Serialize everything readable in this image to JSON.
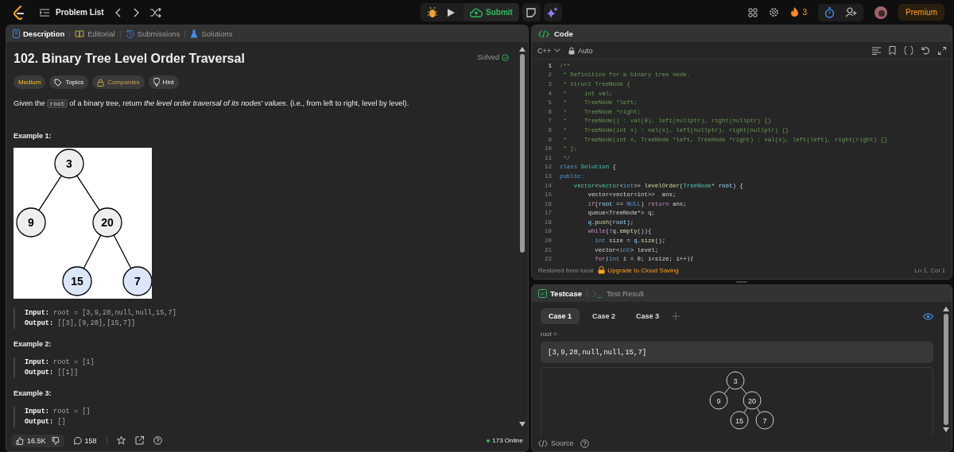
{
  "topbar": {
    "problem_list": "Problem List",
    "submit": "Submit",
    "streak": "3",
    "premium": "Premium"
  },
  "description_panel": {
    "tabs": [
      {
        "label": "Description",
        "kind": "description",
        "selected": true
      },
      {
        "label": "Editorial",
        "kind": "editorial",
        "selected": false
      },
      {
        "label": "Submissions",
        "kind": "submissions",
        "selected": false
      },
      {
        "label": "Solutions",
        "kind": "solutions",
        "selected": false
      }
    ],
    "title": "102. Binary Tree Level Order Traversal",
    "status": "Solved",
    "tags": [
      {
        "label": "Medium",
        "kind": "difficulty"
      },
      {
        "label": "Topics",
        "kind": "topics"
      },
      {
        "label": "Companies",
        "kind": "companies"
      },
      {
        "label": "Hint",
        "kind": "hint"
      }
    ],
    "statement": [
      {
        "kind": "text",
        "text": "Given the "
      },
      {
        "kind": "code",
        "text": "root"
      },
      {
        "kind": "text",
        "text": " of a binary tree, return "
      },
      {
        "kind": "italic",
        "text": "the level order traversal of its nodes' values"
      },
      {
        "kind": "text",
        "text": ". (i.e., from left to right, level by level)."
      }
    ],
    "examples": [
      {
        "title": "Example 1:",
        "figure": {
          "kind": "picture",
          "tree": {
            "label": "3",
            "color": "#eeeeee",
            "children": [
              {
                "label": "9",
                "color": "#eeeeee"
              },
              {
                "label": "20",
                "color": "#eeeeee",
                "children": [
                  {
                    "label": "15",
                    "color": "#dbe6f8"
                  },
                  {
                    "label": "7",
                    "color": "#dbe6f8"
                  }
                ]
              }
            ]
          }
        },
        "lines": [
          "**Input:** root = [3,9,20,null,null,15,7]",
          "**Output:** [[3],[9,20],[15,7]]"
        ]
      },
      {
        "title": "Example 2:",
        "lines": [
          "**Input:** root = [1]",
          "**Output:** [[1]]"
        ]
      },
      {
        "title": "Example 3:",
        "lines": [
          "**Input:** root = []",
          "**Output:** []"
        ]
      }
    ],
    "footer": {
      "likes": "16.5K",
      "comments": "158",
      "online": "173 Online"
    }
  },
  "code_panel": {
    "title": "Code",
    "language": "C++",
    "mode": "Auto",
    "lines": [
      {
        "number": "1",
        "current": true,
        "tokens": [
          {
            "kind": "comment",
            "text": "/**"
          }
        ]
      },
      {
        "number": "2",
        "current": false,
        "tokens": [
          {
            "kind": "comment",
            "text": " * Definition for a binary tree node."
          }
        ]
      },
      {
        "number": "3",
        "current": false,
        "tokens": [
          {
            "kind": "comment",
            "text": " * struct TreeNode {"
          }
        ]
      },
      {
        "number": "4",
        "current": false,
        "tokens": [
          {
            "kind": "comment",
            "text": " *     int val;"
          }
        ]
      },
      {
        "number": "5",
        "current": false,
        "tokens": [
          {
            "kind": "comment",
            "text": " *     TreeNode *left;"
          }
        ]
      },
      {
        "number": "6",
        "current": false,
        "tokens": [
          {
            "kind": "comment",
            "text": " *     TreeNode *right;"
          }
        ]
      },
      {
        "number": "7",
        "current": false,
        "tokens": [
          {
            "kind": "comment",
            "text": " *     TreeNode() : val(0), left(nullptr), right(nullptr) {}"
          }
        ]
      },
      {
        "number": "8",
        "current": false,
        "tokens": [
          {
            "kind": "comment",
            "text": " *     TreeNode(int x) : val(x), left(nullptr), right(nullptr) {}"
          }
        ]
      },
      {
        "number": "9",
        "current": false,
        "tokens": [
          {
            "kind": "comment",
            "text": " *     TreeNode(int x, TreeNode *left, TreeNode *right) : val(x), left(left), right(right) {}"
          }
        ]
      },
      {
        "number": "10",
        "current": false,
        "tokens": [
          {
            "kind": "comment",
            "text": " * };"
          }
        ]
      },
      {
        "number": "11",
        "current": false,
        "tokens": [
          {
            "kind": "comment",
            "text": " */"
          }
        ]
      },
      {
        "number": "12",
        "current": false,
        "tokens": [
          {
            "kind": "keyword",
            "text": "class"
          },
          {
            "kind": "type",
            "text": " Solution"
          },
          {
            "kind": "plain",
            "text": " {"
          }
        ]
      },
      {
        "number": "13",
        "current": false,
        "tokens": [
          {
            "kind": "keyword",
            "text": "public:"
          }
        ]
      },
      {
        "number": "14",
        "current": false,
        "tokens": [
          {
            "kind": "type",
            "text": "    vector"
          },
          {
            "kind": "plain",
            "text": "<"
          },
          {
            "kind": "type",
            "text": "vector"
          },
          {
            "kind": "plain",
            "text": "<"
          },
          {
            "kind": "keyword",
            "text": "int"
          },
          {
            "kind": "plain",
            "text": ">> "
          },
          {
            "kind": "func",
            "text": "levelOrder"
          },
          {
            "kind": "plain",
            "text": "("
          },
          {
            "kind": "type",
            "text": "TreeNode"
          },
          {
            "kind": "plain",
            "text": "* "
          },
          {
            "kind": "var",
            "text": "root"
          },
          {
            "kind": "plain",
            "text": ") {"
          }
        ]
      },
      {
        "number": "15",
        "current": false,
        "tokens": [
          {
            "kind": "plain",
            "text": "        vector<vector<int>>  ans;"
          }
        ]
      },
      {
        "number": "16",
        "current": false,
        "tokens": [
          {
            "kind": "control",
            "text": "        if"
          },
          {
            "kind": "plain",
            "text": "("
          },
          {
            "kind": "var",
            "text": "root"
          },
          {
            "kind": "plain",
            "text": " == "
          },
          {
            "kind": "keyword",
            "text": "NULL"
          },
          {
            "kind": "plain",
            "text": ") "
          },
          {
            "kind": "control",
            "text": "return"
          },
          {
            "kind": "plain",
            "text": " ans;"
          }
        ]
      },
      {
        "number": "17",
        "current": false,
        "tokens": [
          {
            "kind": "plain",
            "text": "        queue<TreeNode*> q;"
          }
        ]
      },
      {
        "number": "18",
        "current": false,
        "tokens": [
          {
            "kind": "var",
            "text": "        q"
          },
          {
            "kind": "plain",
            "text": "."
          },
          {
            "kind": "func",
            "text": "push"
          },
          {
            "kind": "plain",
            "text": "("
          },
          {
            "kind": "var",
            "text": "root"
          },
          {
            "kind": "plain",
            "text": ");"
          }
        ]
      },
      {
        "number": "19",
        "current": false,
        "tokens": [
          {
            "kind": "control",
            "text": "        while"
          },
          {
            "kind": "plain",
            "text": "(!"
          },
          {
            "kind": "var",
            "text": "q"
          },
          {
            "kind": "plain",
            "text": "."
          },
          {
            "kind": "func",
            "text": "empty"
          },
          {
            "kind": "plain",
            "text": "()){"
          }
        ]
      },
      {
        "number": "20",
        "current": false,
        "tokens": [
          {
            "kind": "keyword",
            "text": "          int"
          },
          {
            "kind": "plain",
            "text": " size = "
          },
          {
            "kind": "var",
            "text": "q"
          },
          {
            "kind": "plain",
            "text": "."
          },
          {
            "kind": "func",
            "text": "size"
          },
          {
            "kind": "plain",
            "text": "();"
          }
        ]
      },
      {
        "number": "21",
        "current": false,
        "tokens": [
          {
            "kind": "plain",
            "text": "          vector<"
          },
          {
            "kind": "keyword",
            "text": "int"
          },
          {
            "kind": "plain",
            "text": "> level;"
          }
        ]
      },
      {
        "number": "22",
        "current": false,
        "tokens": [
          {
            "kind": "control",
            "text": "          for"
          },
          {
            "kind": "plain",
            "text": "("
          },
          {
            "kind": "keyword",
            "text": "int"
          },
          {
            "kind": "plain",
            "text": " i = 0; i<size; i++){"
          }
        ]
      }
    ],
    "status": "Restored from local",
    "upgrade": "Upgrade to Cloud Saving",
    "cursor": "Ln 1, Col 1"
  },
  "testcase_panel": {
    "tabs": [
      {
        "label": "Testcase",
        "kind": "testcase",
        "selected": true
      },
      {
        "label": "Test Result",
        "kind": "result",
        "selected": false
      }
    ],
    "cases": [
      {
        "label": "Case 1",
        "selected": true
      },
      {
        "label": "Case 2",
        "selected": false
      },
      {
        "label": "Case 3",
        "selected": false
      }
    ],
    "param_label": "root =",
    "param_value": "[3,9,20,null,null,15,7]",
    "tree": {
      "label": "3",
      "children": [
        {
          "label": "9"
        },
        {
          "label": "20",
          "children": [
            {
              "label": "15"
            },
            {
              "label": "7"
            }
          ]
        }
      ]
    },
    "source": "Source"
  }
}
